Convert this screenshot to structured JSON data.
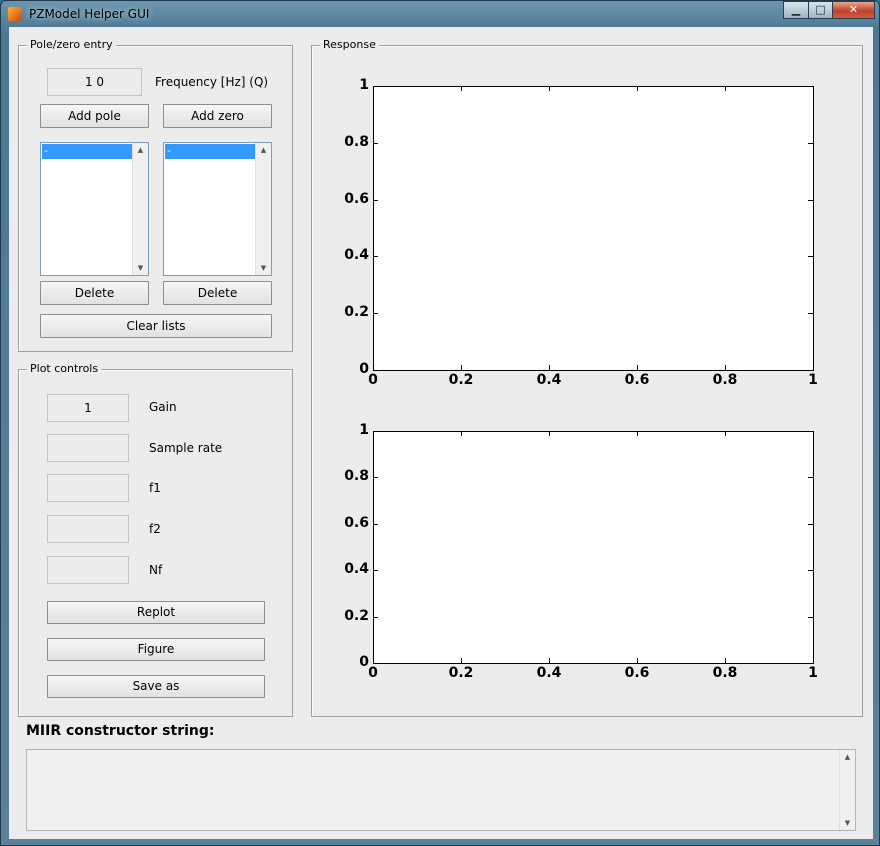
{
  "window": {
    "title": "PZModel Helper GUI",
    "controls": {
      "minimize": "▁",
      "maximize": "□",
      "close": "✕"
    }
  },
  "pole_zero": {
    "group_label": "Pole/zero entry",
    "frequency_value": "1 0",
    "frequency_label": "Frequency [Hz] (Q)",
    "add_pole_label": "Add pole",
    "add_zero_label": "Add zero",
    "poles_list": [
      "-"
    ],
    "zeros_list": [
      "-"
    ],
    "delete_pole_label": "Delete",
    "delete_zero_label": "Delete",
    "clear_lists_label": "Clear lists"
  },
  "plot_controls": {
    "group_label": "Plot controls",
    "gain_value": "1",
    "gain_label": "Gain",
    "sample_rate_value": "",
    "sample_rate_label": "Sample rate",
    "f1_value": "",
    "f1_label": "f1",
    "f2_value": "",
    "f2_label": "f2",
    "nf_value": "",
    "nf_label": "Nf",
    "replot_label": "Replot",
    "figure_label": "Figure",
    "save_as_label": "Save as"
  },
  "response": {
    "group_label": "Response"
  },
  "chart_data": [
    {
      "type": "line",
      "series": [],
      "xlim": [
        0,
        1
      ],
      "ylim": [
        0,
        1
      ],
      "xticks": [
        "0",
        "0.2",
        "0.4",
        "0.6",
        "0.8",
        "1"
      ],
      "yticks": [
        "0",
        "0.2",
        "0.4",
        "0.6",
        "0.8",
        "1"
      ]
    },
    {
      "type": "line",
      "series": [],
      "xlim": [
        0,
        1
      ],
      "ylim": [
        0,
        1
      ],
      "xticks": [
        "0",
        "0.2",
        "0.4",
        "0.6",
        "0.8",
        "1"
      ],
      "yticks": [
        "0",
        "0.2",
        "0.4",
        "0.6",
        "0.8",
        "1"
      ]
    }
  ],
  "miir": {
    "label": "MIIR constructor string:",
    "value": ""
  }
}
